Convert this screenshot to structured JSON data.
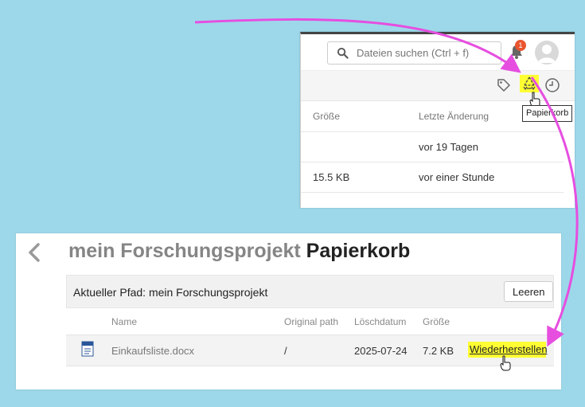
{
  "search": {
    "placeholder": "Dateien suchen (Ctrl + f)"
  },
  "notifications": {
    "badge_count": "1"
  },
  "tooltip": {
    "text": "Papierkorb"
  },
  "file_list": {
    "headers": {
      "size": "Größe",
      "modified": "Letzte Änderung"
    },
    "rows": [
      {
        "size": "",
        "modified": "vor 19 Tagen"
      },
      {
        "size": "15.5 KB",
        "modified": "vor einer Stunde"
      }
    ]
  },
  "trash": {
    "title_project": "mein Forschungsprojekt",
    "title_trash": "Papierkorb",
    "path_label": "Aktueller Pfad: mein Forschungsprojekt",
    "empty_button": "Leeren",
    "columns": {
      "name": "Name",
      "original_path": "Original path",
      "deleted_date": "Löschdatum",
      "size": "Größe"
    },
    "items": [
      {
        "name": "Einkaufsliste.docx",
        "original_path": "/",
        "deleted_date": "2025-07-24",
        "size": "7.2 KB",
        "restore_label": "Wiederherstellen"
      }
    ]
  },
  "colors": {
    "background": "#9dd8ea",
    "highlight": "#ffff33",
    "arrow": "#e64ee0",
    "badge": "#e9552f"
  },
  "icons": [
    "search-icon",
    "bell-icon",
    "avatar-icon",
    "tag-icon",
    "recycle-icon",
    "clock-icon",
    "hand-cursor-icon",
    "chevron-left-icon",
    "docx-file-icon"
  ]
}
